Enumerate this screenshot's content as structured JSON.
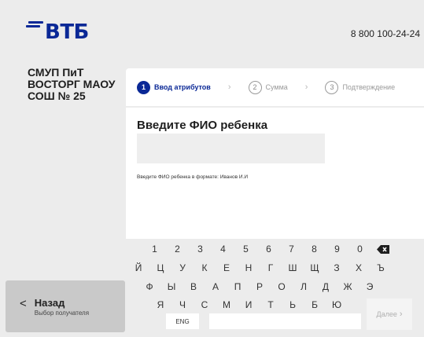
{
  "header": {
    "logo_text": "ВТБ",
    "phone": "8 800 100-24-24",
    "brand_color": "#0a2896"
  },
  "sidebar": {
    "recipient_name": "СМУП ПиТ ВОСТОРГ МАОУ СОШ № 25",
    "back_button": {
      "title": "Назад",
      "subtitle": "Выбор получателя"
    }
  },
  "stepper": {
    "steps": [
      {
        "num": "1",
        "label": "Ввод атрибутов",
        "state": "active"
      },
      {
        "num": "2",
        "label": "Сумма",
        "state": "inactive"
      },
      {
        "num": "3",
        "label": "Подтверждение",
        "state": "inactive"
      }
    ]
  },
  "form": {
    "title": "Введите  ФИО ребенка",
    "input_value": "",
    "hint": "Введите ФИО ребенка в формате: Иванов И.И"
  },
  "keyboard": {
    "rows": [
      [
        "1",
        "2",
        "3",
        "4",
        "5",
        "6",
        "7",
        "8",
        "9",
        "0"
      ],
      [
        "Й",
        "Ц",
        "У",
        "К",
        "Е",
        "Н",
        "Г",
        "Ш",
        "Щ",
        "З",
        "Х",
        "Ъ"
      ],
      [
        "Ф",
        "Ы",
        "В",
        "А",
        "П",
        "Р",
        "О",
        "Л",
        "Д",
        "Ж",
        "Э"
      ],
      [
        "Я",
        "Ч",
        "С",
        "М",
        "И",
        "Т",
        "Ь",
        "Б",
        "Ю"
      ]
    ],
    "lang_key": "ENG",
    "next_label": "Далее",
    "next_arrow": "›",
    "delete_icon": "backspace-icon"
  }
}
